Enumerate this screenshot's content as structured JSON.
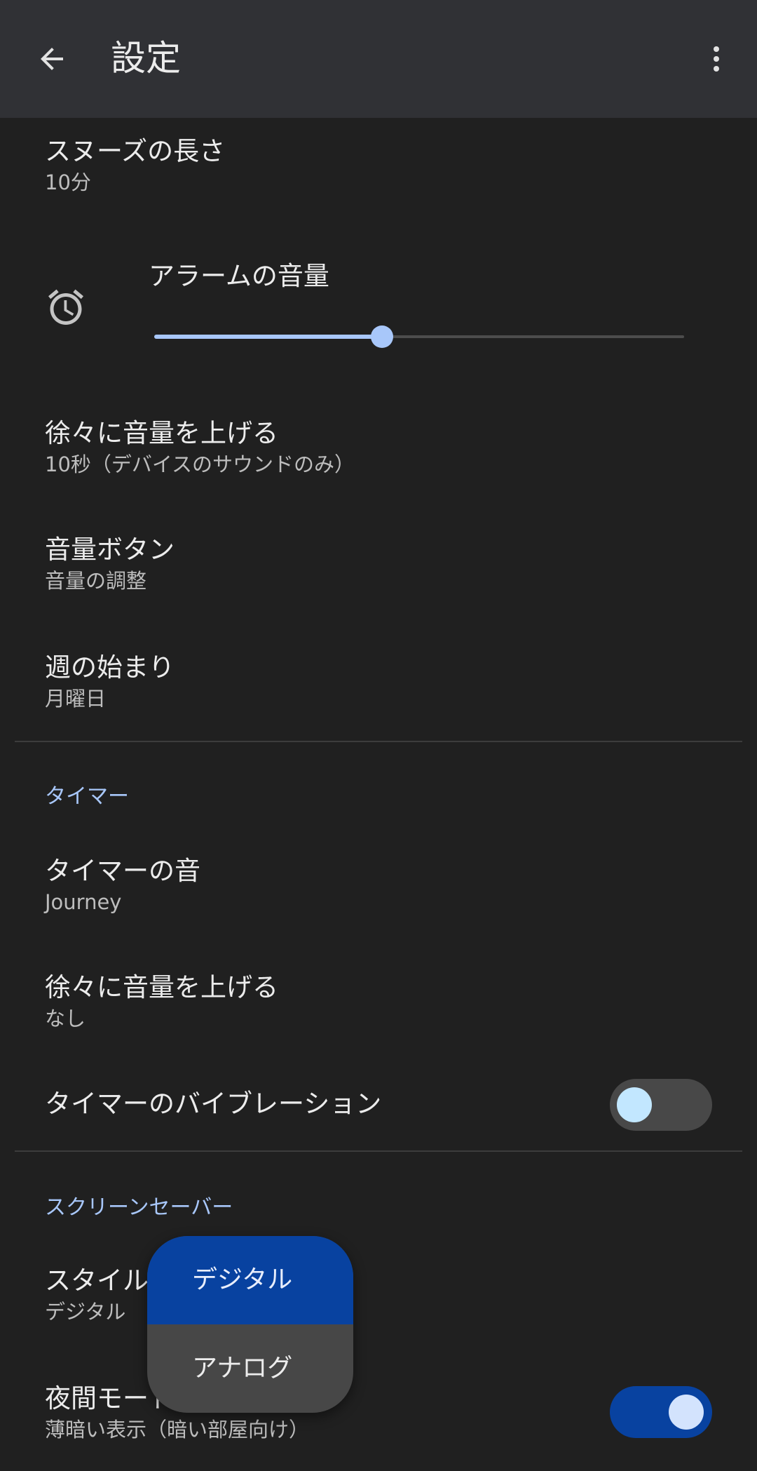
{
  "appbar": {
    "title": "設定",
    "back_icon": "arrow-left-icon",
    "more_icon": "more-vert-icon"
  },
  "alarm": {
    "snooze": {
      "title": "スヌーズの長さ",
      "value": "10分"
    },
    "volume": {
      "label": "アラームの音量",
      "icon": "alarm-clock-icon",
      "level_fraction": 0.43
    },
    "gradual_volume": {
      "title": "徐々に音量を上げる",
      "value": "10秒（デバイスのサウンドのみ）"
    },
    "volume_buttons": {
      "title": "音量ボタン",
      "value": "音量の調整"
    },
    "week_start": {
      "title": "週の始まり",
      "value": "月曜日"
    }
  },
  "timer": {
    "header": "タイマー",
    "sound": {
      "title": "タイマーの音",
      "value": "Journey"
    },
    "gradual_volume": {
      "title": "徐々に音量を上げる",
      "value": "なし"
    },
    "vibration": {
      "title": "タイマーのバイブレーション",
      "enabled": false
    }
  },
  "screensaver": {
    "header": "スクリーンセーバー",
    "style": {
      "title": "スタイル",
      "value": "デジタル"
    },
    "night_mode": {
      "title": "夜間モード",
      "value": "薄暗い表示（暗い部屋向け）",
      "enabled": true
    }
  },
  "style_popup": {
    "options": [
      "デジタル",
      "アナログ"
    ],
    "selected": "デジタル"
  },
  "colors": {
    "accent": "#a8c7fa",
    "toggle_on": "#0842a0",
    "background": "#202020",
    "appbar": "#303135"
  }
}
